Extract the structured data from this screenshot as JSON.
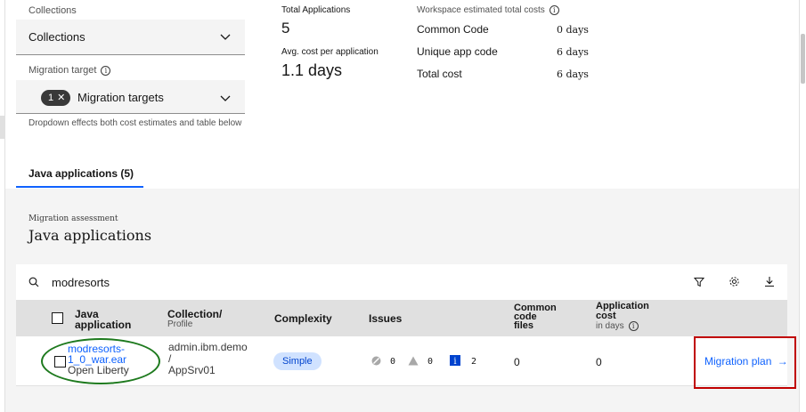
{
  "filters": {
    "collections_label": "Collections",
    "collections_value": "Collections",
    "migration_target_label": "Migration target",
    "migration_target_count": "1",
    "migration_target_value": "Migration targets",
    "helper_text": "Dropdown effects both cost estimates and table below"
  },
  "summary": {
    "total_apps_label": "Total Applications",
    "total_apps_value": "5",
    "avg_cost_label": "Avg. cost per application",
    "avg_cost_value": "1.1 days"
  },
  "costs": {
    "header": "Workspace estimated total costs",
    "rows": [
      {
        "label": "Common Code",
        "value": "0 days"
      },
      {
        "label": "Unique app code",
        "value": "6 days"
      },
      {
        "label": "Total cost",
        "value": "6 days"
      }
    ]
  },
  "tabs": [
    {
      "label": "Java applications (5)"
    }
  ],
  "assessment": {
    "eyebrow": "Migration assessment",
    "title": "Java applications"
  },
  "search": {
    "value": "modresorts"
  },
  "table": {
    "headers": {
      "app_line1": "Java",
      "app_line2": "application",
      "collection": "Collection/",
      "collection_sub": "Profile",
      "complexity": "Complexity",
      "issues": "Issues",
      "common_line1": "Common",
      "common_line2": "code",
      "common_line3": "files",
      "cost_line1": "Application",
      "cost_line2": "cost",
      "cost_sub": "in days"
    },
    "rows": [
      {
        "app_name_line1": "modresorts-",
        "app_name_line2": "1_0_war.ear",
        "target": "Open Liberty",
        "collection_line1": "admin.ibm.demo",
        "collection_line2": "/",
        "collection_line3": "AppSrv01",
        "complexity": "Simple",
        "issues_critical": "0",
        "issues_warning": "0",
        "issues_info": "2",
        "common_files": "0",
        "cost": "0",
        "action": "Migration plan"
      }
    ]
  },
  "colors": {
    "accent": "#0f62fe",
    "annotation_green": "#1e7a1e",
    "annotation_red": "#c00000"
  }
}
